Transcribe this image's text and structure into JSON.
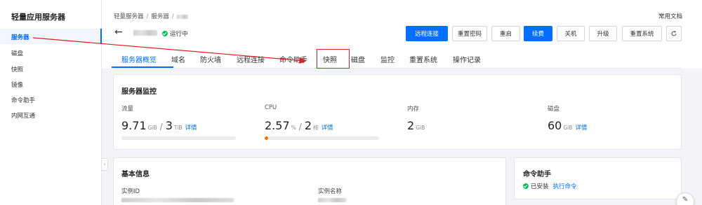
{
  "sidebar": {
    "title": "轻量应用服务器",
    "items": [
      {
        "label": "服务器",
        "active": true
      },
      {
        "label": "磁盘",
        "active": false
      },
      {
        "label": "快照",
        "active": false
      },
      {
        "label": "镜像",
        "active": false
      },
      {
        "label": "命令助手",
        "active": false
      },
      {
        "label": "内网互通",
        "active": false
      }
    ],
    "collapse_icon": "chevron-left"
  },
  "header": {
    "breadcrumb": [
      "轻量服务器",
      "服务器"
    ],
    "docs_label": "常用文档",
    "status_label": "运行中",
    "back_icon": "arrow-left"
  },
  "toolbar": {
    "remote": "远程连接",
    "reset_password": "重置密码",
    "reboot": "重启",
    "renew": "续费",
    "shutdown": "关机",
    "upgrade": "升级",
    "reinstall": "重置系统",
    "refresh_icon": "refresh"
  },
  "tabs": [
    "服务器概览",
    "域名",
    "防火墙",
    "远程连接",
    "命令助手",
    "快照",
    "磁盘",
    "监控",
    "重置系统",
    "操作记录"
  ],
  "monitor": {
    "title": "服务器监控",
    "traffic": {
      "label": "流量",
      "used": "9.71",
      "used_unit": "GiB",
      "sep": "/",
      "total": "3",
      "total_unit": "TiB",
      "link": "详情",
      "usage_fraction": 0.0
    },
    "cpu": {
      "label": "CPU",
      "value": "2.57",
      "unit": "%",
      "sep": "/",
      "cores": "2",
      "cores_unit": "核",
      "link": "详情",
      "usage_fraction": 0.0257
    },
    "memory": {
      "label": "内存",
      "value": "2",
      "unit": "GiB"
    },
    "disk": {
      "label": "磁盘",
      "value": "60",
      "unit": "GiB",
      "link": "详情"
    }
  },
  "basic_info": {
    "title": "基本信息",
    "instance_id_label": "实例ID",
    "instance_name_label": "实例名称"
  },
  "command_helper": {
    "title": "命令助手",
    "installed": "已安装",
    "run_link": "执行命令"
  },
  "colors": {
    "accent": "#006eff",
    "success": "#0abf5b",
    "annotation": "#e02020",
    "cpu_bar": "#ff7200"
  }
}
